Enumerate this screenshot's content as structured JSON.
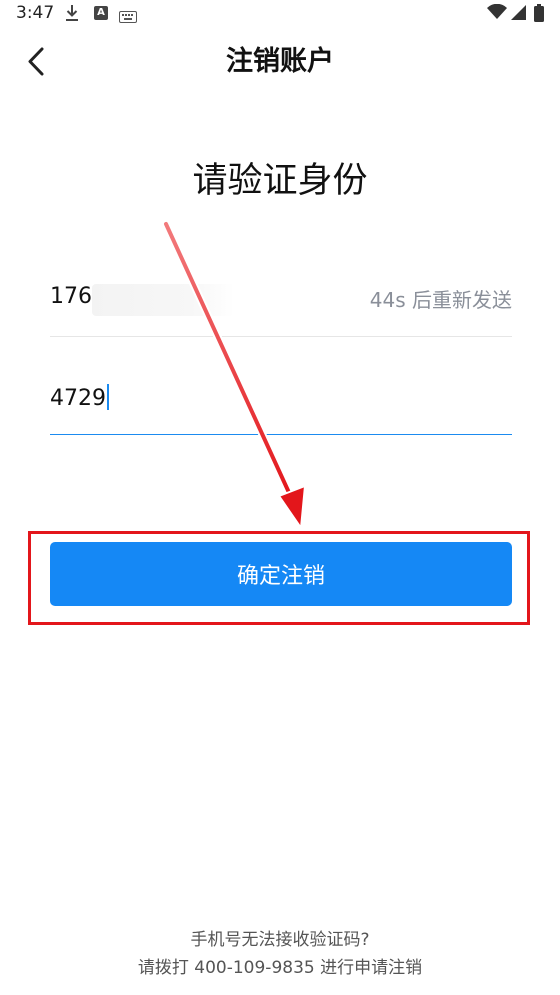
{
  "status_bar": {
    "time": "3:47",
    "icons": [
      "download-icon",
      "a-notification-icon",
      "keyboard-icon",
      "wifi-icon",
      "signal-icon",
      "battery-icon"
    ]
  },
  "header": {
    "title": "注销账户",
    "back_icon": "chevron-left-icon"
  },
  "verify": {
    "heading": "请验证身份",
    "phone_prefix": "176",
    "resend_label": "44s 后重新发送",
    "code_value": "4729"
  },
  "confirm": {
    "label": "确定注销"
  },
  "footer": {
    "line1": "手机号无法接收验证码?",
    "line2": "请拨打 400-109-9835 进行申请注销"
  },
  "colors": {
    "accent": "#1588f5",
    "annotation": "#e3161b"
  }
}
